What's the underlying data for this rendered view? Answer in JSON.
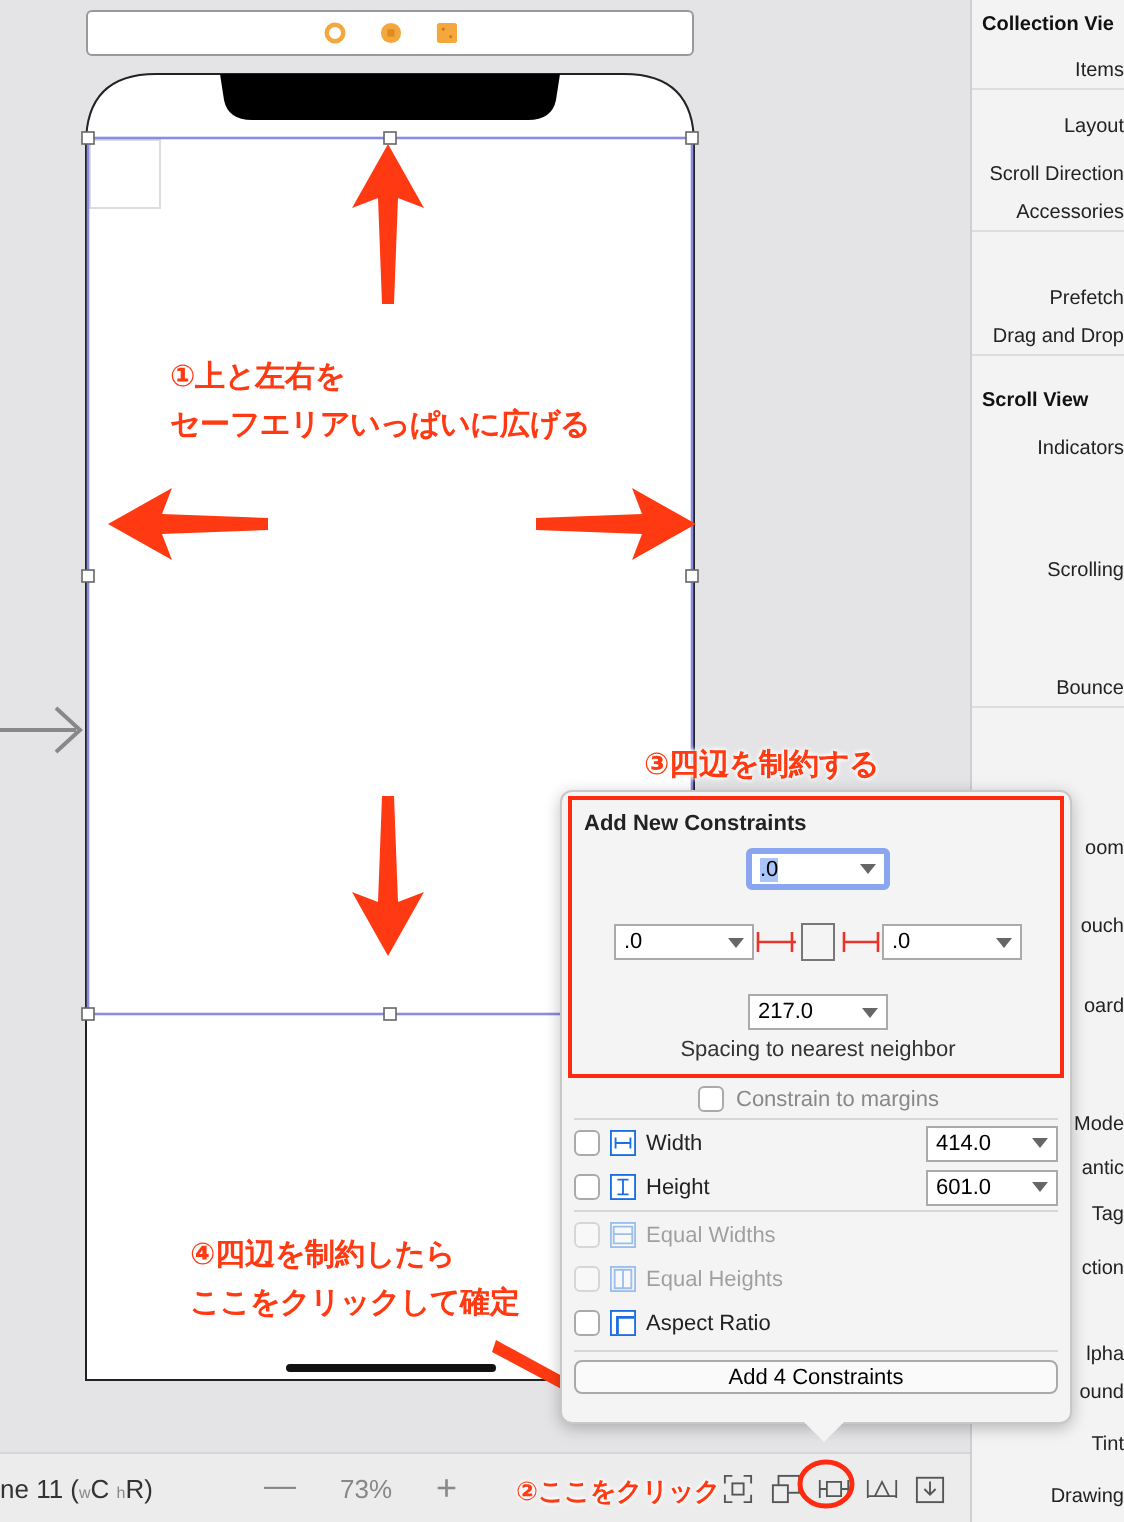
{
  "inspector": {
    "labels": [
      {
        "text": "Collection Vie",
        "kind": "header"
      },
      {
        "text": "Items",
        "kind": "label"
      },
      {
        "text": "Layout",
        "kind": "label"
      },
      {
        "text": "Scroll Direction",
        "kind": "label"
      },
      {
        "text": "Accessories",
        "kind": "label"
      },
      {
        "text": "Prefetch",
        "kind": "label"
      },
      {
        "text": "Drag and Drop",
        "kind": "label"
      },
      {
        "text": "Scroll View",
        "kind": "header"
      },
      {
        "text": "Indicators",
        "kind": "label"
      },
      {
        "text": "Scrolling",
        "kind": "label"
      },
      {
        "text": "Bounce",
        "kind": "label"
      },
      {
        "text": "oom",
        "kind": "label"
      },
      {
        "text": "ouch",
        "kind": "label"
      },
      {
        "text": "oard",
        "kind": "label"
      },
      {
        "text": "Mode",
        "kind": "label"
      },
      {
        "text": "antic",
        "kind": "label"
      },
      {
        "text": "Tag",
        "kind": "label"
      },
      {
        "text": "ction",
        "kind": "label"
      },
      {
        "text": "lpha",
        "kind": "label"
      },
      {
        "text": "ound",
        "kind": "label"
      },
      {
        "text": "Tint",
        "kind": "label"
      },
      {
        "text": "Drawing",
        "kind": "label"
      }
    ]
  },
  "annotations": [
    {
      "lines": [
        "①上と左右を",
        "セーフエリアいっぱいに広げる"
      ]
    },
    {
      "lines": [
        "③四辺を制約する"
      ]
    },
    {
      "lines": [
        "④四辺を制約したら",
        "ここをクリックして確定"
      ]
    },
    {
      "lines": [
        "②ここをクリック"
      ]
    }
  ],
  "toolbar": {
    "device": "ne 11 ($_{w}$C $_{h}$R)",
    "zoom_out": "—",
    "zoom": "73%",
    "zoom_in": "+"
  },
  "popover": {
    "title": "Add New Constraints",
    "fields": [
      {
        "value": ".0",
        "selected": true
      },
      {
        "value": ".0",
        "selected": false
      },
      {
        "value": ".0",
        "selected": false
      },
      {
        "value": "217.0",
        "selected": false
      }
    ],
    "caption": "Spacing to nearest neighbor",
    "margins": {
      "label": "Constrain to margins",
      "checked": false
    },
    "size_rows": [
      {
        "label": "Width",
        "checked": false,
        "value": "414.0"
      },
      {
        "label": "Height",
        "checked": false,
        "value": "601.0"
      }
    ],
    "relation_rows": [
      {
        "label": "Equal Widths",
        "checked": false,
        "disabled": true
      },
      {
        "label": "Equal Heights",
        "checked": false,
        "disabled": true
      },
      {
        "label": "Aspect Ratio",
        "checked": false,
        "disabled": false
      }
    ],
    "button": "Add 4 Constraints"
  }
}
